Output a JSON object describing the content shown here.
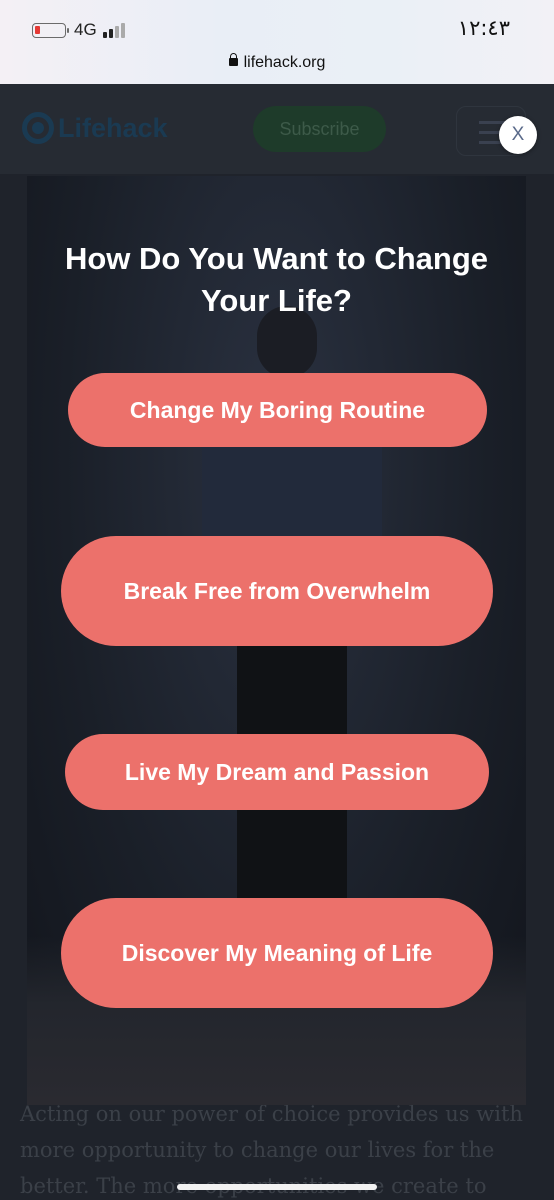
{
  "status_bar": {
    "network": "4G",
    "time": "١٢:٤٣",
    "url": "lifehack.org"
  },
  "site_header": {
    "logo_text": "Lifehack",
    "subscribe_label": "Subscribe"
  },
  "article": {
    "bottom_text": "Acting on our power of choice provides us with more opportunity to change our lives for the better. The more opportunities we create to change"
  },
  "popup": {
    "title": "How Do You Want to Change Your Life?",
    "options": [
      {
        "label": "Change My Boring Routine"
      },
      {
        "label": "Break Free from Overwhelm"
      },
      {
        "label": "Live My Dream and Passion"
      },
      {
        "label": "Discover My Meaning of Life"
      }
    ],
    "close_label": "X"
  },
  "colors": {
    "option_bg": "#ec716b",
    "overlay": "#1f232b"
  }
}
